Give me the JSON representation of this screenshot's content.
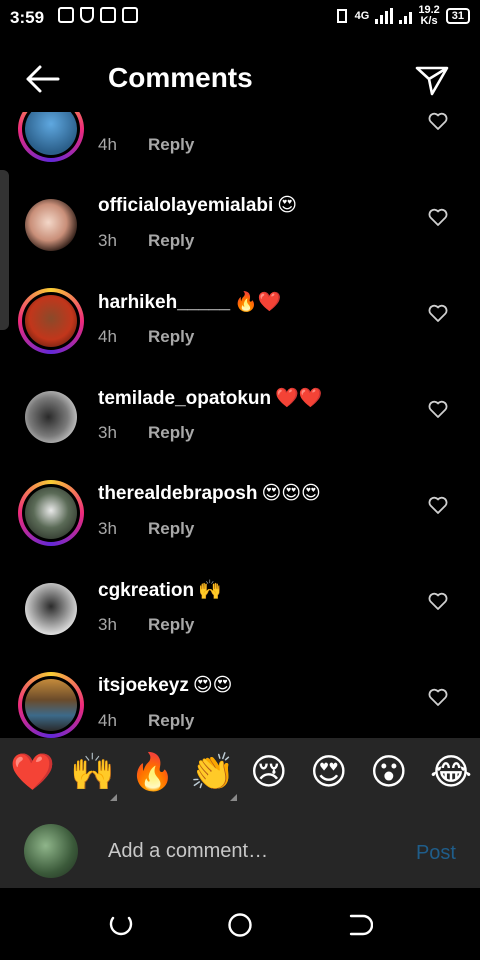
{
  "status_bar": {
    "time": "3:59",
    "network": "4G",
    "speed_value": "19.2",
    "speed_unit": "K/s",
    "battery": "31"
  },
  "header": {
    "title": "Comments"
  },
  "comments": [
    {
      "username": "",
      "emoji": "",
      "time": "4h",
      "reply": "Reply"
    },
    {
      "username": "officialolayemialabi",
      "emoji": "😍",
      "time": "3h",
      "reply": "Reply"
    },
    {
      "username": "harhikeh_____",
      "emoji": "🔥❤️",
      "time": "4h",
      "reply": "Reply"
    },
    {
      "username": "temilade_opatokun",
      "emoji": "❤️❤️",
      "time": "3h",
      "reply": "Reply"
    },
    {
      "username": "therealdebraposh",
      "emoji": "😍😍😍",
      "time": "3h",
      "reply": "Reply"
    },
    {
      "username": "cgkreation",
      "emoji": "🙌",
      "time": "3h",
      "reply": "Reply"
    },
    {
      "username": "itsjoekeyz",
      "emoji": "😍😍",
      "time": "4h",
      "reply": "Reply"
    }
  ],
  "reactions": [
    "❤️",
    "🙌",
    "🔥",
    "👏",
    "😢",
    "😍",
    "😮",
    "😂"
  ],
  "composer": {
    "placeholder": "Add a comment…",
    "post_label": "Post"
  },
  "colors": {
    "background": "#000000",
    "panel": "#262626",
    "muted_text": "#a8a8a8",
    "post_disabled": "#1f5d8a",
    "heart_red": "#e0245e"
  }
}
